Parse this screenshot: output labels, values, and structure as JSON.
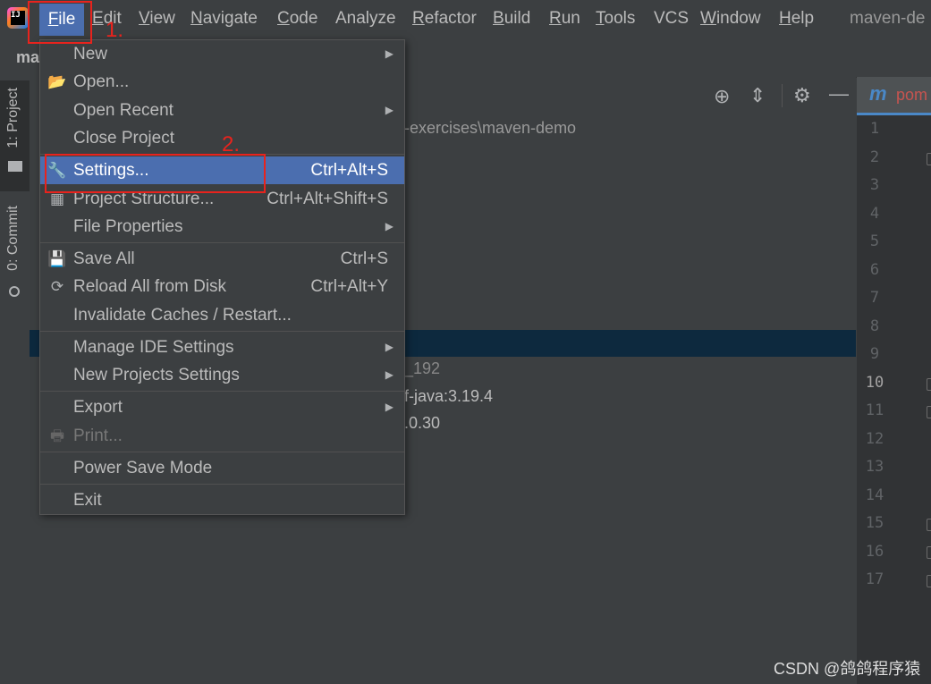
{
  "menubar": {
    "items": [
      {
        "label": "File",
        "underline": "F",
        "rest": "ile"
      },
      {
        "label": "Edit",
        "underline": "E",
        "rest": "dit"
      },
      {
        "label": "View",
        "underline": "V",
        "rest": "iew"
      },
      {
        "label": "Navigate",
        "underline": "N",
        "rest": "avigate"
      },
      {
        "label": "Code",
        "underline": "C",
        "rest": "ode"
      },
      {
        "label": "Analyze",
        "underline": "",
        "rest": "Analyze"
      },
      {
        "label": "Refactor",
        "underline": "R",
        "rest": "efactor"
      },
      {
        "label": "Build",
        "underline": "B",
        "rest": "uild"
      },
      {
        "label": "Run",
        "underline": "R",
        "rest": "un"
      },
      {
        "label": "Tools",
        "underline": "T",
        "rest": "ools"
      },
      {
        "label": "VCS",
        "underline": "",
        "rest": "VCS"
      },
      {
        "label": "Window",
        "underline": "W",
        "rest": "indow"
      },
      {
        "label": "Help",
        "underline": "H",
        "rest": "elp"
      }
    ],
    "window_title": "maven-de"
  },
  "navbar": {
    "crumb": "ma"
  },
  "tool_windows": {
    "project": "1: Project",
    "commit": "0: Commit"
  },
  "project_panel": {
    "path": "-exercises\\maven-demo",
    "tree_fragments": [
      "_192",
      "f-java:3.19.4",
      ".0.30"
    ]
  },
  "editor": {
    "tab_icon": "m",
    "tab_name": "pom",
    "line_numbers": [
      "1",
      "2",
      "3",
      "4",
      "5",
      "6",
      "7",
      "8",
      "9",
      "10",
      "11",
      "12",
      "13",
      "14",
      "15",
      "16",
      "17"
    ],
    "active_line": "10"
  },
  "file_menu": {
    "items": [
      {
        "label": "New",
        "submenu": true,
        "icon": ""
      },
      {
        "label": "Open...",
        "icon": "folder-icon"
      },
      {
        "label": "Open Recent",
        "submenu": true
      },
      {
        "label": "Close Project"
      },
      {
        "label": "Settings...",
        "shortcut": "Ctrl+Alt+S",
        "icon": "wrench-icon",
        "highlighted": true
      },
      {
        "label": "Project Structure...",
        "shortcut": "Ctrl+Alt+Shift+S",
        "icon": "project-structure-icon"
      },
      {
        "label": "File Properties",
        "submenu": true
      },
      {
        "label": "Save All",
        "shortcut": "Ctrl+S",
        "icon": "save-icon"
      },
      {
        "label": "Reload All from Disk",
        "shortcut": "Ctrl+Alt+Y",
        "icon": "reload-icon"
      },
      {
        "label": "Invalidate Caches / Restart..."
      },
      {
        "label": "Manage IDE Settings",
        "submenu": true
      },
      {
        "label": "New Projects Settings",
        "submenu": true
      },
      {
        "label": "Export",
        "submenu": true
      },
      {
        "label": "Print...",
        "icon": "printer-icon",
        "disabled": true
      },
      {
        "label": "Power Save Mode"
      },
      {
        "label": "Exit"
      }
    ]
  },
  "annotations": {
    "step1": "1.",
    "step2": "2."
  },
  "watermark": "CSDN @鸽鸽程序猿",
  "colors": {
    "highlight": "#4b6eaf",
    "annotation_red": "#e8231d",
    "selection_row": "#0d293e"
  }
}
